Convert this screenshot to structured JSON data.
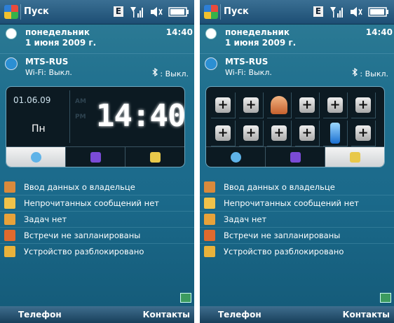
{
  "topbar": {
    "start_label": "Пуск",
    "network_letter": "E"
  },
  "today": {
    "weekday": "понедельник",
    "date": "1 июня 2009 г.",
    "time": "14:40"
  },
  "operator": {
    "name": "MTS-RUS",
    "wifi": "Wi-Fi: Выкл.",
    "bluetooth": ": Выкл."
  },
  "clock_widget": {
    "date": "01.06.09",
    "day": "Пн",
    "am": "AM",
    "pm": "PM",
    "time": "14:40"
  },
  "list": [
    {
      "label": "Ввод данных о владельце",
      "icon": "owner-icon",
      "color": "#d98a3c"
    },
    {
      "label": "Непрочитанных сообщений нет",
      "icon": "mail-icon",
      "color": "#f0c24a"
    },
    {
      "label": "Задач нет",
      "icon": "tasks-icon",
      "color": "#e8a23a"
    },
    {
      "label": "Встречи не запланированы",
      "icon": "calendar-icon",
      "color": "#e06a2e"
    },
    {
      "label": "Устройство разблокировано",
      "icon": "lock-icon",
      "color": "#e9b23c"
    }
  ],
  "softkeys": {
    "left": "Телефон",
    "right": "Контакты"
  },
  "launcher_grid": [
    "plus",
    "plus",
    "person",
    "plus",
    "plus",
    "plus",
    "plus",
    "plus",
    "plus",
    "plus",
    "battery",
    "plus"
  ],
  "colors": {
    "tab_clock": "#5fb3e8",
    "tab_purple": "#7a4bd6",
    "tab_settings": "#e8c84a"
  }
}
